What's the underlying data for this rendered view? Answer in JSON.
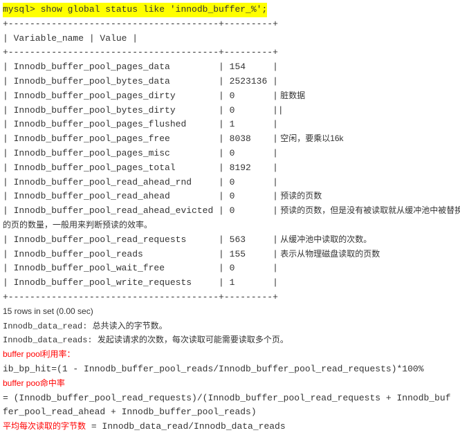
{
  "query_prompt": "mysql> show global status like 'innodb_buffer_%';",
  "header_border": "+---------------------------------------+---------+",
  "header_row": "| Variable_name                         | Value   |",
  "rows": [
    {
      "text": "| Innodb_buffer_pool_pages_data         | 154     |",
      "comment": ""
    },
    {
      "text": "| Innodb_buffer_pool_bytes_data         | 2523136 |",
      "comment": ""
    },
    {
      "text": "| Innodb_buffer_pool_pages_dirty        | 0       |",
      "comment": "脏数据"
    },
    {
      "text": "| Innodb_buffer_pool_bytes_dirty        | 0       ||",
      "comment": ""
    },
    {
      "text": "| Innodb_buffer_pool_pages_flushed      | 1       |",
      "comment": ""
    },
    {
      "text": "| Innodb_buffer_pool_pages_free         | 8038    |",
      "comment": "空闲，要乘以16k"
    },
    {
      "text": "| Innodb_buffer_pool_pages_misc         | 0       |",
      "comment": ""
    },
    {
      "text": "| Innodb_buffer_pool_pages_total        | 8192    |",
      "comment": ""
    },
    {
      "text": "| Innodb_buffer_pool_read_ahead_rnd     | 0       |",
      "comment": ""
    },
    {
      "text": "| Innodb_buffer_pool_read_ahead         | 0       |",
      "comment": "预读的页数"
    },
    {
      "text": "| Innodb_buffer_pool_read_ahead_evicted | 0       |",
      "comment": "预读的页数，但是没有被读取就从缓冲池中被替换"
    },
    {
      "text": "的页的数量，一般用来判断预读的效率。",
      "comment": "",
      "full_sans": true
    },
    {
      "text": "| Innodb_buffer_pool_read_requests      | 563     |",
      "comment": "从缓冲池中读取的次数。"
    },
    {
      "text": "| Innodb_buffer_pool_reads              | 155     |",
      "comment": "表示从物理磁盘读取的页数"
    },
    {
      "text": "| Innodb_buffer_pool_wait_free          | 0       |",
      "comment": ""
    },
    {
      "text": "| Innodb_buffer_pool_write_requests     | 1       |",
      "comment": ""
    }
  ],
  "footer_border": "+---------------------------------------+---------+",
  "result_count": "15 rows in set (0.00 sec)",
  "notes": {
    "data_read": "Innodb_data_read: 总共读入的字节数。",
    "data_reads": "Innodb_data_reads: 发起读请求的次数，每次读取可能需要读取多个页。",
    "util_label": "   buffer pool利用率：",
    "util_formula": "ib_bp_hit=(1 - Innodb_buffer_pool_reads/Innodb_buffer_pool_read_requests)*100%",
    "hit_label": "   buffer poo命中率",
    "hit_formula": "= (Innodb_buffer_pool_read_requests)/(Innodb_buffer_pool_read_requests + Innodb_buffer_pool_read_ahead + Innodb_buffer_pool_reads)",
    "avg_label": "  平均每次读取的字节数",
    "avg_formula": " = Innodb_data_read/Innodb_data_reads"
  }
}
